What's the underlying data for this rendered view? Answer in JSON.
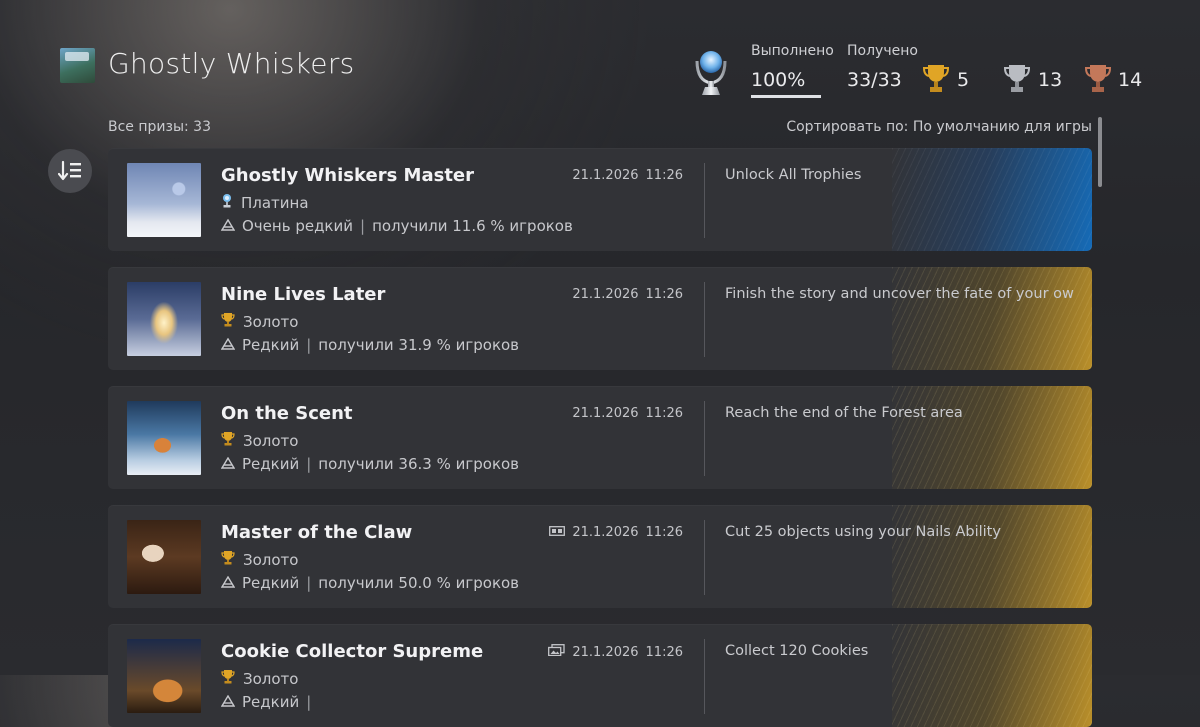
{
  "header": {
    "game_title": "Ghostly Whiskers",
    "completed_label": "Выполнено",
    "completed_value": "100%",
    "completed_progress": 1.0,
    "earned_label": "Получено",
    "earned_value": "33/33",
    "gold_count": "5",
    "silver_count": "13",
    "bronze_count": "14"
  },
  "list": {
    "all_trophies": "Все призы: 33",
    "sort_label": "Сортировать по: По умолчанию для игры"
  },
  "colors": {
    "platinum_accent": "#1a6fc0",
    "gold_accent": "#d4a22a",
    "background": "#2a2b2f",
    "card": "#323337"
  },
  "trophies": [
    {
      "name": "Ghostly Whiskers Master",
      "grade": "Платина",
      "grade_icon": "platinum-trophy-icon",
      "rarity": "Очень редкий",
      "percent": "получили 11.6 % игроков",
      "date": "21.1.2026",
      "time": "11:26",
      "date_icon": "",
      "description": "Unlock All Trophies"
    },
    {
      "name": "Nine Lives Later",
      "grade": "Золото",
      "grade_icon": "gold-trophy-icon",
      "rarity": "Редкий",
      "percent": "получили 31.9 % игроков",
      "date": "21.1.2026",
      "time": "11:26",
      "date_icon": "",
      "description": "Finish the story and uncover the fate of your owner"
    },
    {
      "name": "On the Scent",
      "grade": "Золото",
      "grade_icon": "gold-trophy-icon",
      "rarity": "Редкий",
      "percent": "получили 36.3 % игроков",
      "date": "21.1.2026",
      "time": "11:26",
      "date_icon": "",
      "description": "Reach the end of the Forest area"
    },
    {
      "name": "Master of the Claw",
      "grade": "Золото",
      "grade_icon": "gold-trophy-icon",
      "rarity": "Редкий",
      "percent": "получили 50.0 % игроков",
      "date": "21.1.2026",
      "time": "11:26",
      "date_icon": "video-clip-icon",
      "description": "Cut 25 objects using your Nails Ability"
    },
    {
      "name": "Cookie Collector Supreme",
      "grade": "Золото",
      "grade_icon": "gold-trophy-icon",
      "rarity": "Редкий",
      "percent": "",
      "date": "21.1.2026",
      "time": "11:26",
      "date_icon": "screenshot-gallery-icon",
      "description": "Collect 120 Cookies"
    }
  ]
}
